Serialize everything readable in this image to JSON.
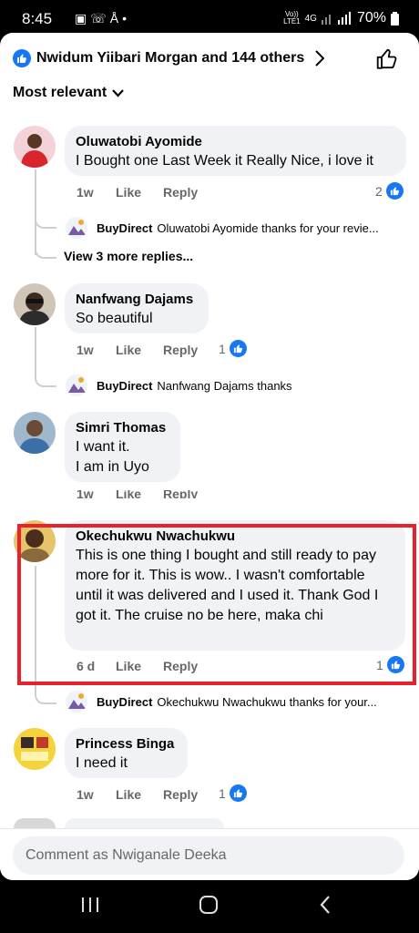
{
  "status": {
    "time": "8:45",
    "network_top": "Vo))",
    "network_bottom": "LTE1",
    "network_type": "4G",
    "battery": "70%"
  },
  "header": {
    "reactors_text": "Nwidum Yiibari Morgan and 144 others",
    "sort_label": "Most relevant"
  },
  "comments": [
    {
      "name": "Oluwatobi Ayomide",
      "text": "I Bought one Last Week it Really Nice, i love it",
      "time": "1w",
      "like": "Like",
      "reply": "Reply",
      "reactions": "2",
      "replies": [
        {
          "name": "BuyDirect",
          "text": "Oluwatobi Ayomide thanks for your revie..."
        }
      ],
      "more_replies": "View 3 more replies..."
    },
    {
      "name": "Nanfwang Dajams",
      "text": "So beautiful",
      "time": "1w",
      "like": "Like",
      "reply": "Reply",
      "reactions": "1",
      "replies": [
        {
          "name": "BuyDirect",
          "text": "Nanfwang Dajams thanks"
        }
      ]
    },
    {
      "name": "Simri Thomas",
      "text": "I want it.\nI am in Uyo",
      "time": "1w",
      "like": "Like",
      "reply": "Reply"
    },
    {
      "name": "Okechukwu Nwachukwu",
      "text": "This is one thing I bought and still ready to pay more for it. This is wow.. I wasn't comfortable until it was delivered and I used it. Thank God I got it. The cruise  no be here, maka chi",
      "time": "6 d",
      "like": "Like",
      "reply": "Reply",
      "reactions": "1",
      "replies": [
        {
          "name": "BuyDirect",
          "text": "Okechukwu Nwachukwu thanks for your..."
        }
      ]
    },
    {
      "name": "Princess Binga",
      "text": "I need it",
      "time": "1w",
      "like": "Like",
      "reply": "Reply",
      "reactions": "1"
    }
  ],
  "composer": {
    "placeholder": "Comment as Nwiganale Deeka"
  },
  "colors": {
    "accent": "#1877f2",
    "bubble": "#f0f2f5",
    "highlight": "#e8212d"
  }
}
